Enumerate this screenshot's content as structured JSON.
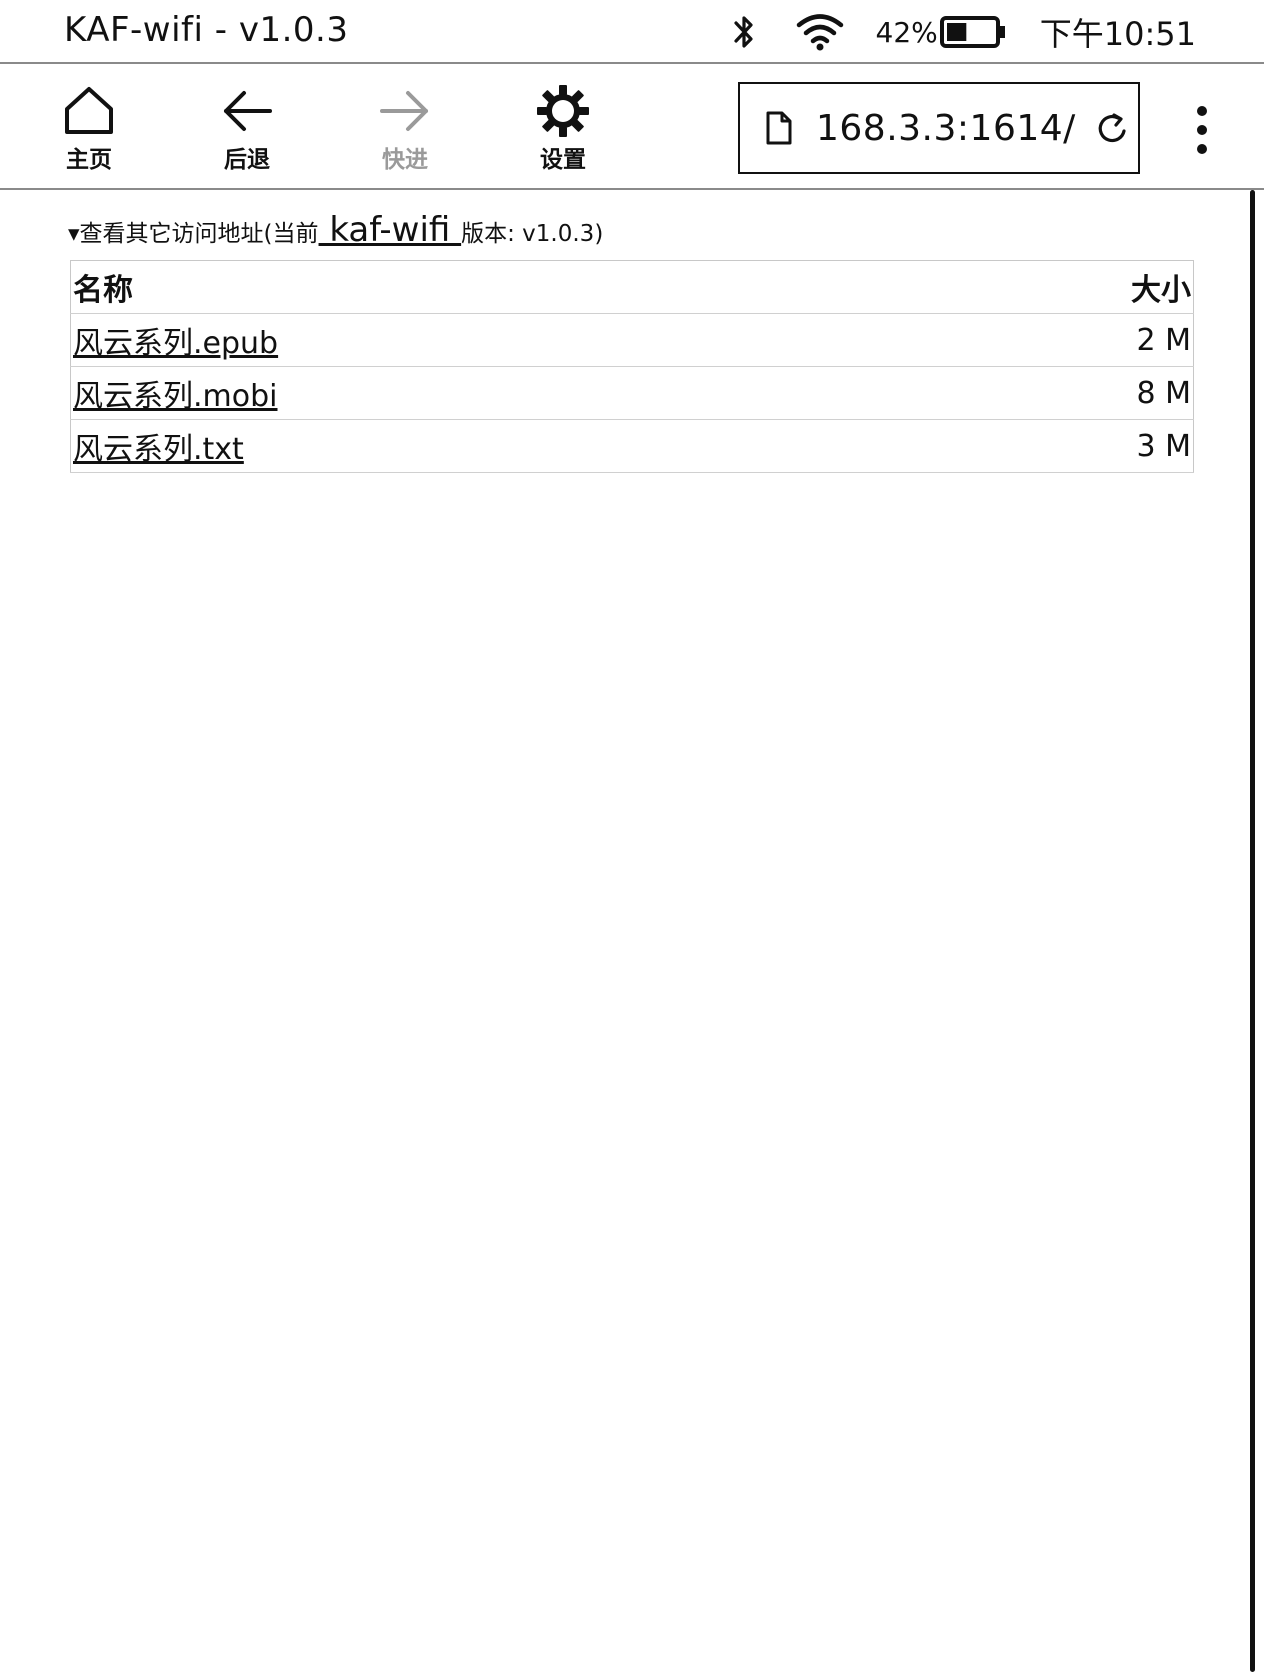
{
  "status_bar": {
    "title": "KAF-wifi - v1.0.3",
    "battery_percent": "42%",
    "battery_level": 0.42,
    "time": "下午10:51",
    "icons": [
      "bluetooth-icon",
      "wifi-icon",
      "battery-icon"
    ]
  },
  "toolbar": {
    "home_label": "主页",
    "back_label": "后退",
    "forward_label": "快进",
    "settings_label": "设置",
    "url": "168.3.3:1614/",
    "forward_disabled": true
  },
  "content": {
    "summary_prefix": "▾查看其它访问地址(当前",
    "summary_link": " kaf-wifi ",
    "summary_suffix": "版本: v1.0.3)",
    "table": {
      "headers": {
        "name": "名称",
        "size": "大小"
      },
      "rows": [
        {
          "name": "风云系列.epub",
          "size": "2 M"
        },
        {
          "name": "风云系列.mobi",
          "size": "8 M"
        },
        {
          "name": "风云系列.txt",
          "size": "3 M"
        }
      ]
    }
  },
  "colors": {
    "text": "#111111",
    "disabled": "#9a9a9a",
    "divider": "#8a8a8a",
    "background": "#ffffff"
  }
}
